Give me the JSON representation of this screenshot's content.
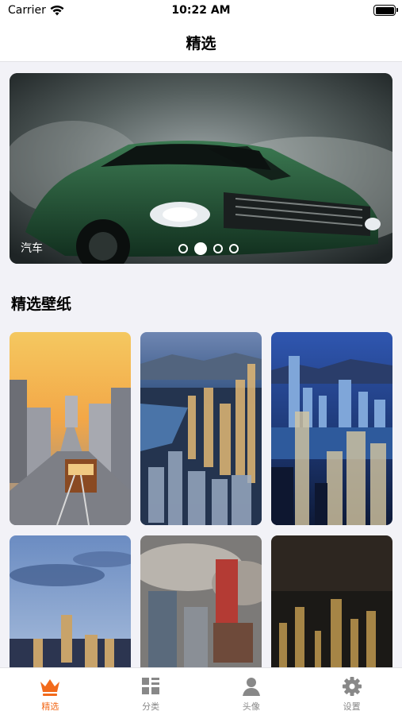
{
  "status_bar": {
    "carrier": "Carrier",
    "time": "10:22 AM"
  },
  "nav": {
    "title": "精选"
  },
  "banner": {
    "caption": "汽车",
    "page_count": 4,
    "active_page": 2
  },
  "section": {
    "title": "精选壁纸"
  },
  "wallpapers": [
    {
      "subject": "San Francisco street with cable car at sunset"
    },
    {
      "subject": "Hong Kong skyline aerial at dusk"
    },
    {
      "subject": "Hong Kong harbour night skyline"
    },
    {
      "subject": "City skyline at twilight"
    },
    {
      "subject": "Urban street with billboards"
    },
    {
      "subject": "City lights at night"
    }
  ],
  "tabs": [
    {
      "label": "精选",
      "icon": "crown-icon",
      "active": true
    },
    {
      "label": "分类",
      "icon": "category-grid-icon",
      "active": false
    },
    {
      "label": "头像",
      "icon": "person-icon",
      "active": false
    },
    {
      "label": "设置",
      "icon": "gear-icon",
      "active": false
    }
  ],
  "colors": {
    "accent": "#f26a1b",
    "inactive_tab": "#888888",
    "background": "#f2f2f7"
  }
}
